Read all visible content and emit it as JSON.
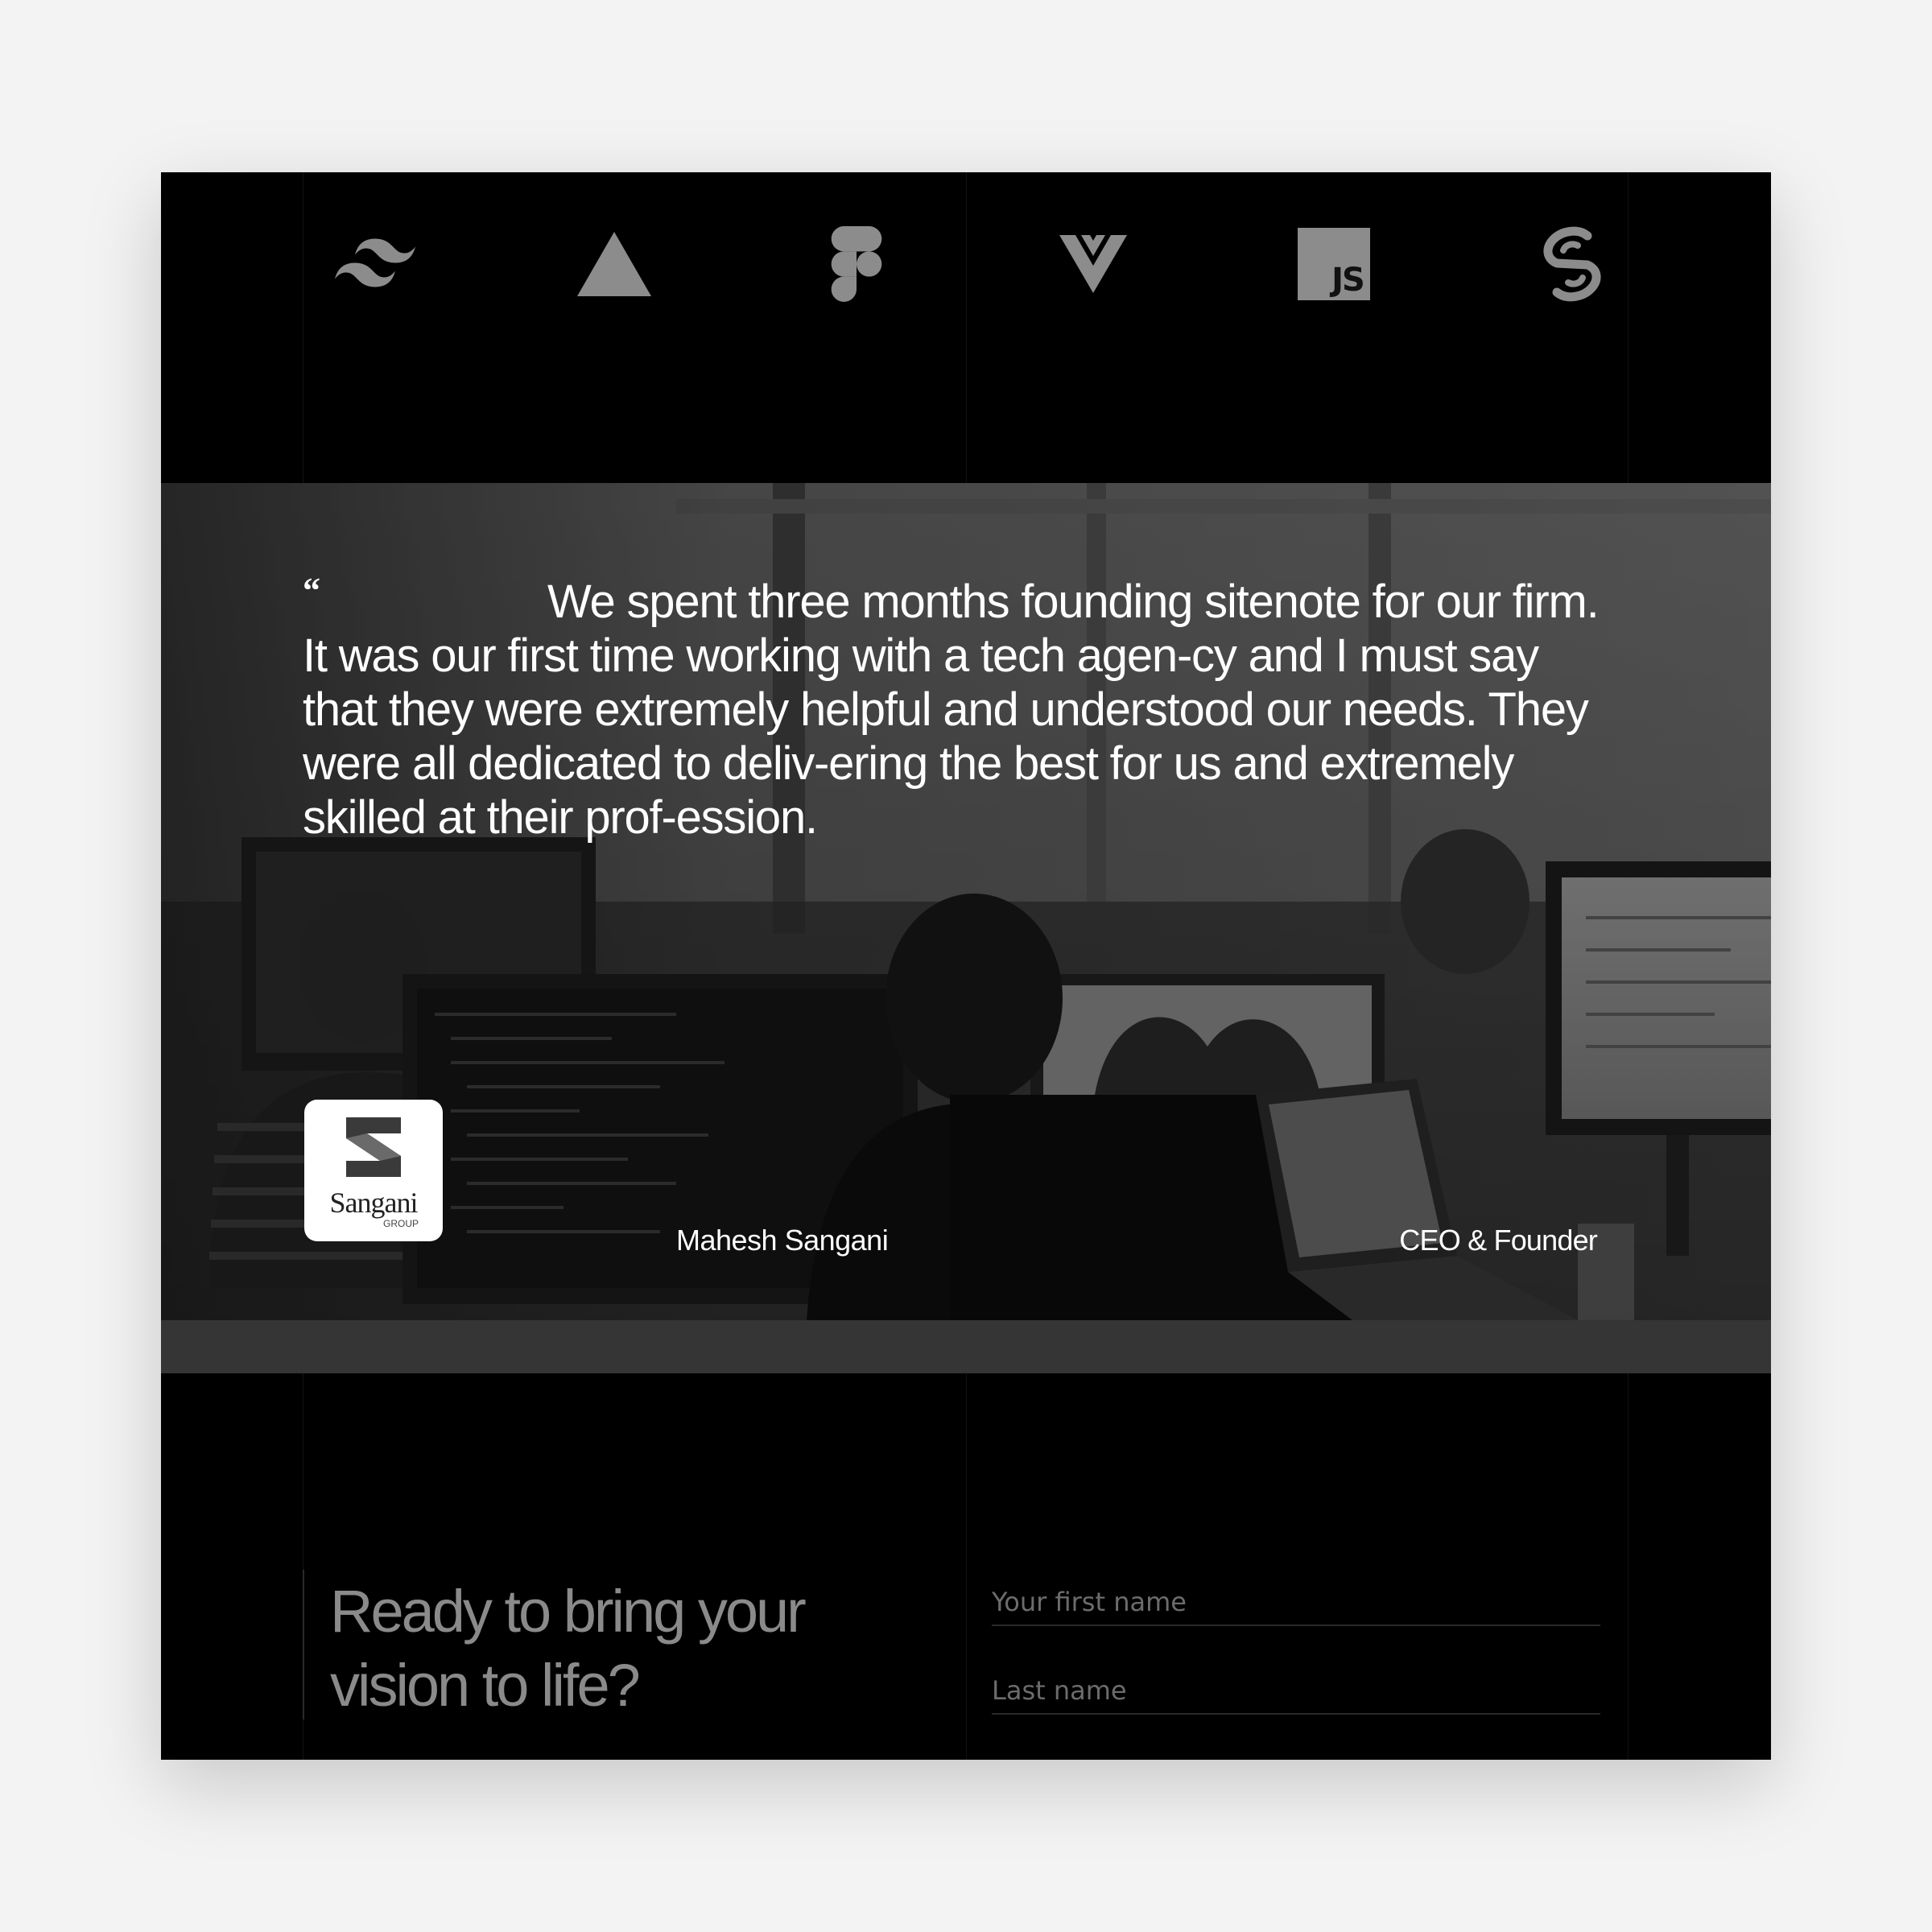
{
  "logos": [
    {
      "name": "tailwind-icon"
    },
    {
      "name": "triangle-icon"
    },
    {
      "name": "figma-icon"
    },
    {
      "name": "vue-icon"
    },
    {
      "name": "javascript-icon",
      "label": "JS"
    },
    {
      "name": "svelte-icon"
    }
  ],
  "testimonial": {
    "quote_mark": "“",
    "quote": "We spent three months founding sitenote for our firm. It was our first time working with a tech agen-cy and I must say that they were extremely helpful and understood our needs. They were all dedicated to deliv-ering the best for us and extremely skilled at their prof-ession.",
    "company": {
      "name": "Sangani",
      "subtitle": "GROUP"
    },
    "author_name": "Mahesh Sangani",
    "author_role": "CEO & Founder"
  },
  "cta": {
    "heading": "Ready to bring your vision to life?",
    "first_name_placeholder": "Your first name",
    "last_name_placeholder": "Last name"
  },
  "colors": {
    "background": "#000000",
    "logo_gray": "#8c8c8c",
    "heading_gray": "#8a8a8a",
    "page_bg": "#f3f3f3"
  }
}
